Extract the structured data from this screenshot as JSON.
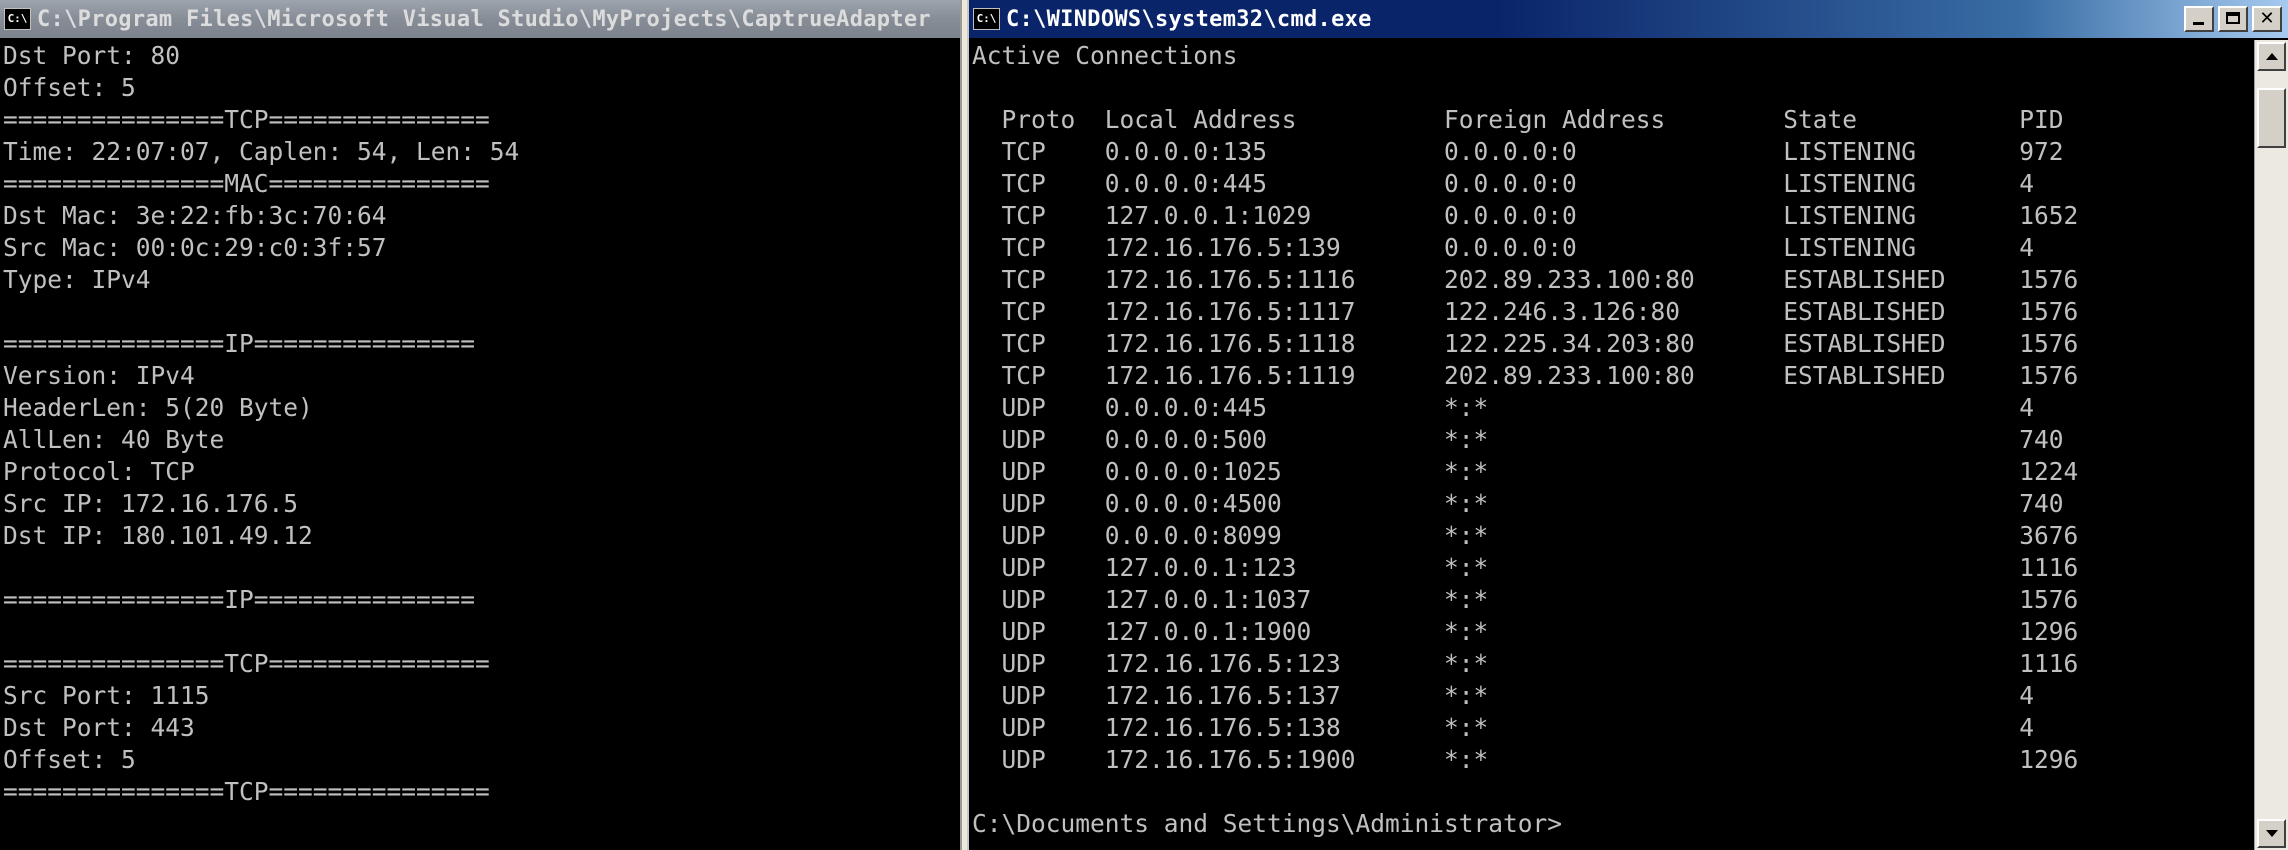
{
  "left_window": {
    "title": "C:\\Program Files\\Microsoft Visual Studio\\MyProjects\\CaptrueAdapter",
    "icon": "console-icon",
    "lines": [
      "Dst Port: 80",
      "Offset: 5",
      "===============TCP===============",
      "Time: 22:07:07, Caplen: 54, Len: 54",
      "===============MAC===============",
      "Dst Mac: 3e:22:fb:3c:70:64",
      "Src Mac: 00:0c:29:c0:3f:57",
      "Type: IPv4",
      "",
      "===============IP===============",
      "Version: IPv4",
      "HeaderLen: 5(20 Byte)",
      "AllLen: 40 Byte",
      "Protocol: TCP",
      "Src IP: 172.16.176.5",
      "Dst IP: 180.101.49.12",
      "",
      "===============IP===============",
      "",
      "===============TCP===============",
      "Src Port: 1115",
      "Dst Port: 443",
      "Offset: 5",
      "===============TCP==============="
    ]
  },
  "right_window": {
    "title": "C:\\WINDOWS\\system32\\cmd.exe",
    "icon": "console-icon",
    "lines": [
      "Active Connections",
      "",
      "  Proto  Local Address          Foreign Address        State           PID",
      "  TCP    0.0.0.0:135            0.0.0.0:0              LISTENING       972",
      "  TCP    0.0.0.0:445            0.0.0.0:0              LISTENING       4",
      "  TCP    127.0.0.1:1029         0.0.0.0:0              LISTENING       1652",
      "  TCP    172.16.176.5:139       0.0.0.0:0              LISTENING       4",
      "  TCP    172.16.176.5:1116      202.89.233.100:80      ESTABLISHED     1576",
      "  TCP    172.16.176.5:1117      122.246.3.126:80       ESTABLISHED     1576",
      "  TCP    172.16.176.5:1118      122.225.34.203:80      ESTABLISHED     1576",
      "  TCP    172.16.176.5:1119      202.89.233.100:80      ESTABLISHED     1576",
      "  UDP    0.0.0.0:445            *:*                                    4",
      "  UDP    0.0.0.0:500            *:*                                    740",
      "  UDP    0.0.0.0:1025           *:*                                    1224",
      "  UDP    0.0.0.0:4500           *:*                                    740",
      "  UDP    0.0.0.0:8099           *:*                                    3676",
      "  UDP    127.0.0.1:123          *:*                                    1116",
      "  UDP    127.0.0.1:1037         *:*                                    1576",
      "  UDP    127.0.0.1:1900         *:*                                    1296",
      "  UDP    172.16.176.5:123       *:*                                    1116",
      "  UDP    172.16.176.5:137       *:*                                    4",
      "  UDP    172.16.176.5:138       *:*                                    4",
      "  UDP    172.16.176.5:1900      *:*                                    1296",
      "",
      "C:\\Documents and Settings\\Administrator>"
    ]
  },
  "colors": {
    "console_bg": "#000000",
    "console_text": "#c0c0c0",
    "title_active": "#0a246a",
    "title_inactive": "#868d97"
  }
}
